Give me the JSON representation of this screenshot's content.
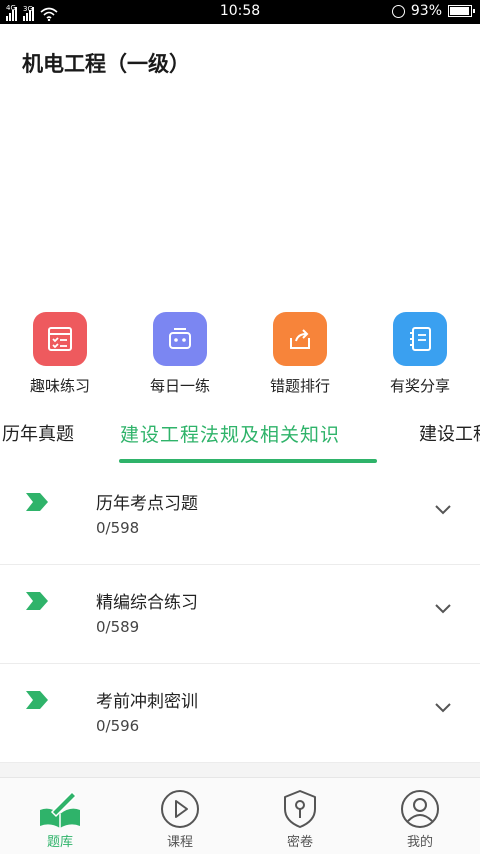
{
  "status_bar": {
    "network_1": "4G",
    "network_2": "3G",
    "time": "10:58",
    "battery": "93%",
    "battery_level": 0.93
  },
  "header": {
    "title": "机电工程（一级）"
  },
  "quick_actions": [
    {
      "label": "趣味练习",
      "icon": "practice-icon",
      "color": "#ee5a5e"
    },
    {
      "label": "每日一练",
      "icon": "robot-icon",
      "color": "#7b86f2"
    },
    {
      "label": "错题排行",
      "icon": "share-box-icon",
      "color": "#f7843a"
    },
    {
      "label": "有奖分享",
      "icon": "notebook-icon",
      "color": "#3aa0f0"
    }
  ],
  "tabs": [
    {
      "label": "历年真题"
    },
    {
      "label": "建设工程法规及相关知识"
    },
    {
      "label": "建设工程"
    }
  ],
  "accent_color": "#2fb36a",
  "list": [
    {
      "title": "历年考点习题",
      "count": "0/598"
    },
    {
      "title": "精编综合练习",
      "count": "0/589"
    },
    {
      "title": "考前冲刺密训",
      "count": "0/596"
    }
  ],
  "bottom_nav": [
    {
      "label": "题库",
      "icon": "book-pen-icon"
    },
    {
      "label": "课程",
      "icon": "play-icon"
    },
    {
      "label": "密卷",
      "icon": "shield-key-icon"
    },
    {
      "label": "我的",
      "icon": "user-icon"
    }
  ]
}
